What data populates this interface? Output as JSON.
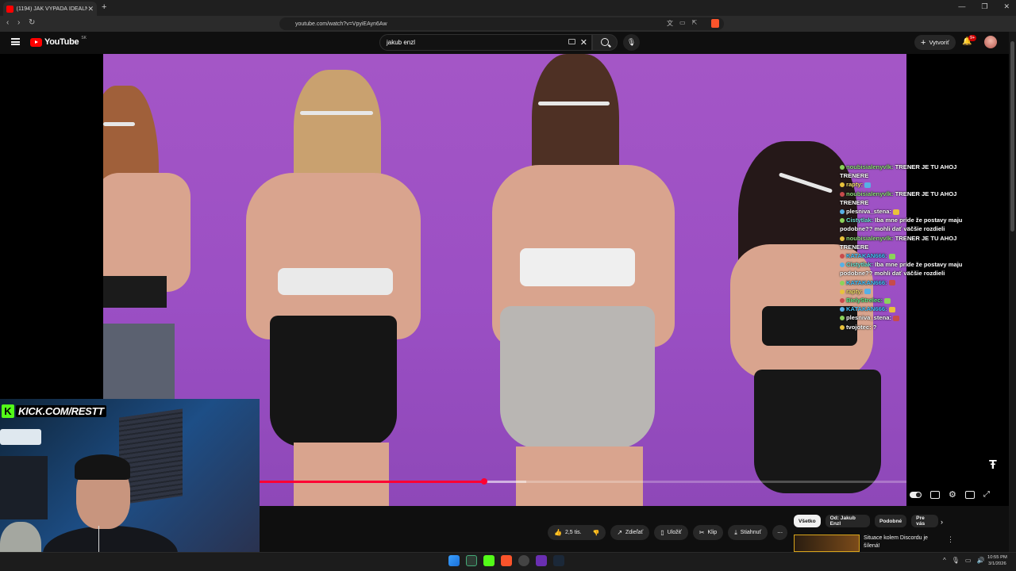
{
  "browser": {
    "tab_title": "(1194) JAK VYPADÁ IDEÁLNÍ",
    "url": "youtube.com/watch?v=VpyiEAyn6Aw"
  },
  "header": {
    "logo_text": "YouTube",
    "region": "SK",
    "search_value": "jakub enzl",
    "create_label": "Vytvoriť",
    "notification_count": "9+"
  },
  "chat": {
    "messages": [
      {
        "user": "noubisialenyvlk:",
        "text": " TRENER JE TU AHOJ TRENERE",
        "user_color": "#8fe07a"
      },
      {
        "user": "rapty:",
        "text": "",
        "user_color": "#f3e26b"
      },
      {
        "user": "noubisialenyvlk:",
        "text": " TRENER JE TU AHOJ TRENERE",
        "user_color": "#8fe07a"
      },
      {
        "user": "plesniva_stena:",
        "text": "",
        "user_color": "#ffffff"
      },
      {
        "user": "Cistytlak:",
        "text": " Iba mne príde že postavy maju podobne?? mohli dať väčšie rozdieli",
        "user_color": "#6fe6d6"
      },
      {
        "user": "noubisialenyvlk:",
        "text": " TRENER JE TU AHOJ TRENERE",
        "user_color": "#8fe07a"
      },
      {
        "user": "KATAKAN666:",
        "text": "",
        "user_color": "#46c6ff"
      },
      {
        "user": "Cistytlak:",
        "text": " Iba mne príde že postavy maju podobne?? mohli dať väčšie rozdieli",
        "user_color": "#6fe6d6"
      },
      {
        "user": "KATAKAN666:",
        "text": "",
        "user_color": "#46c6ff"
      },
      {
        "user": "rapty:",
        "text": "",
        "user_color": "#f3e26b"
      },
      {
        "user": "BielyStrelec:",
        "text": "",
        "user_color": "#5ef08d"
      },
      {
        "user": "KATAKAN666:",
        "text": "",
        "user_color": "#46c6ff"
      },
      {
        "user": "plesniva_stena:",
        "text": "",
        "user_color": "#ffffff"
      },
      {
        "user": "tvojotec:",
        "text": " ?",
        "user_color": "#ffffff"
      }
    ]
  },
  "player": {
    "progress_played": 0.347,
    "progress_buffered": 0.412
  },
  "overlay": {
    "kick_label": "KICK.COM/RESTT"
  },
  "actions": {
    "likes": "2,5 tis.",
    "share": "Zdieľať",
    "save": "Uložiť",
    "clip": "Klip",
    "download": "Stiahnuť"
  },
  "chips": [
    "Všetko",
    "Od: Jakub Enzl",
    "Podobné",
    "Pre vás"
  ],
  "recommendation": {
    "title": "Situace kolem Discordu je šílená!"
  },
  "clock": {
    "time": "10:55 PM",
    "date": "3/1/2026"
  },
  "colors": {
    "accent": "#ff0033",
    "kick_green": "#53fc18"
  }
}
